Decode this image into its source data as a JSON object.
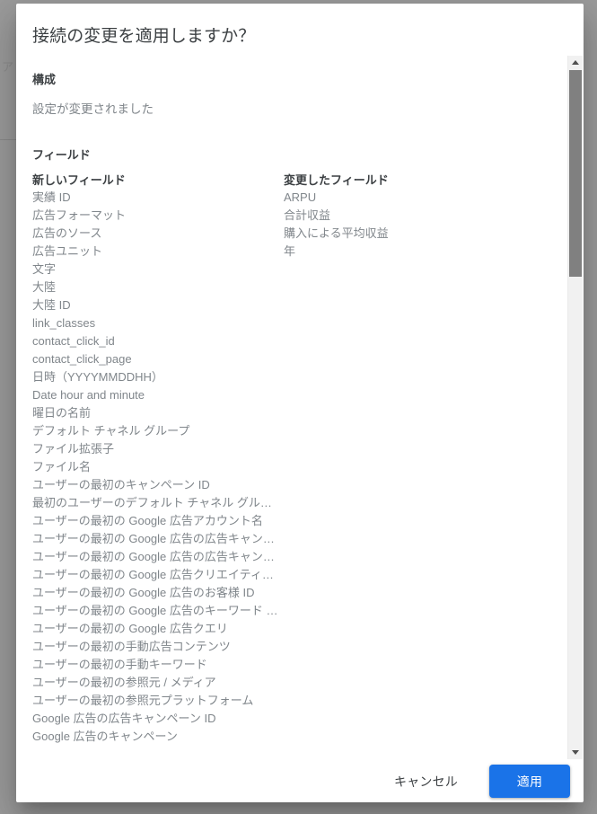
{
  "backdrop": {
    "ghost_text": "ア"
  },
  "dialog": {
    "title": "接続の変更を適用しますか？",
    "configuration": {
      "heading": "構成",
      "description": "設定が変更されました"
    },
    "fields": {
      "heading": "フィールド",
      "new_fields_header": "新しいフィールド",
      "changed_fields_header": "変更したフィールド",
      "new_fields": [
        "実績 ID",
        "広告フォーマット",
        "広告のソース",
        "広告ユニット",
        "文字",
        "大陸",
        "大陸 ID",
        "link_classes",
        "contact_click_id",
        "contact_click_page",
        "日時（YYYYMMDDHH）",
        "Date hour and minute",
        "曜日の名前",
        "デフォルト チャネル グループ",
        "ファイル拡張子",
        "ファイル名",
        "ユーザーの最初のキャンペーン ID",
        "最初のユーザーのデフォルト チャネル グル…",
        "ユーザーの最初の Google 広告アカウント名",
        "ユーザーの最初の Google 広告の広告キャン…",
        "ユーザーの最初の Google 広告の広告キャン…",
        "ユーザーの最初の Google 広告クリエイティ…",
        "ユーザーの最初の Google 広告のお客様 ID",
        "ユーザーの最初の Google 広告のキーワード …",
        "ユーザーの最初の Google 広告クエリ",
        "ユーザーの最初の手動広告コンテンツ",
        "ユーザーの最初の手動キーワード",
        "ユーザーの最初の参照元 / メディア",
        "ユーザーの最初の参照元プラットフォーム",
        "Google 広告の広告キャンペーン ID",
        "Google 広告のキャンペーン"
      ],
      "changed_fields": [
        "ARPU",
        "合計収益",
        "購入による平均収益",
        "年"
      ]
    },
    "footer": {
      "cancel_label": "キャンセル",
      "apply_label": "適用"
    },
    "scrollbar": {
      "up_arrow": "scroll-up-arrow-icon",
      "down_arrow": "scroll-down-arrow-icon"
    }
  },
  "colors": {
    "accent": "#1a73e8",
    "text_primary": "#3c4043",
    "text_secondary": "#80868b",
    "backdrop": "#9c9c9c"
  }
}
